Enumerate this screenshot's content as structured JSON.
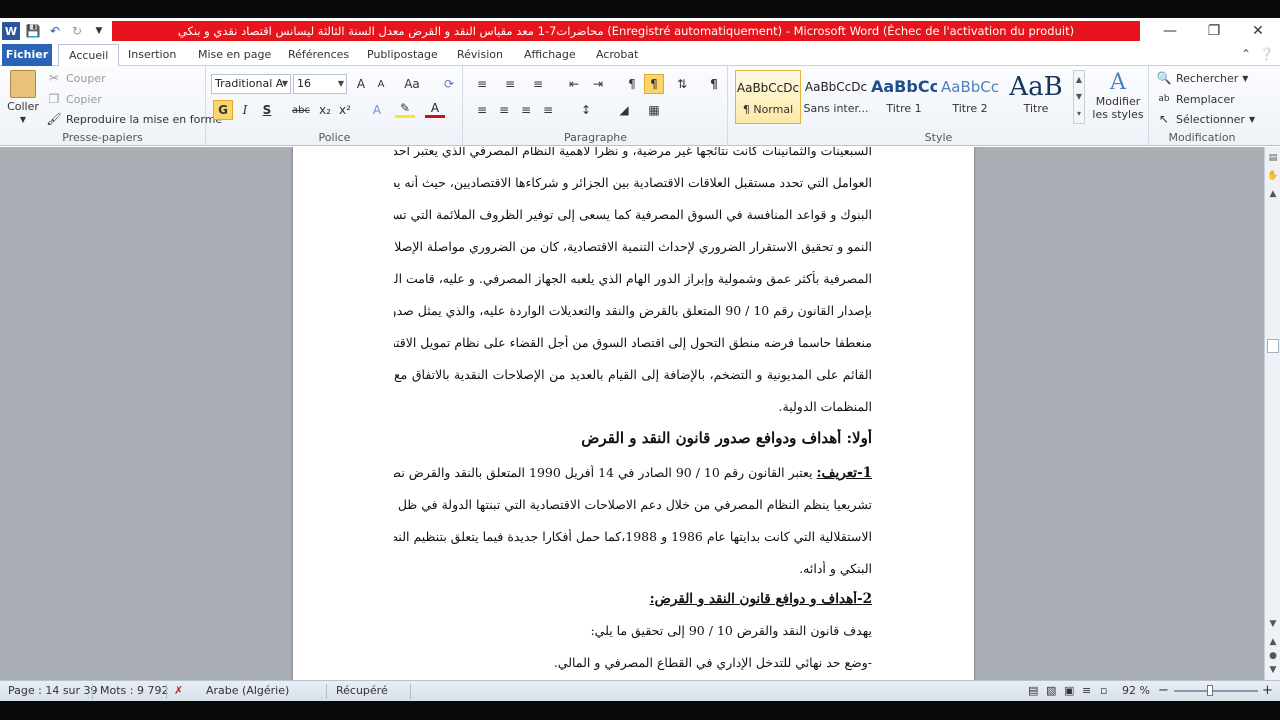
{
  "window": {
    "title": "محاضرات7-1  معد مقياس النقد و القرض معدل السنة الثالثة ليسانس اقتصاد نقدي و بنكي (Enregistré automatiquement)  -  Microsoft Word (Échec de l'activation du produit)",
    "app_icon": "W"
  },
  "tabs": [
    "Fichier",
    "Accueil",
    "Insertion",
    "Mise en page",
    "Références",
    "Publipostage",
    "Révision",
    "Affichage",
    "Acrobat"
  ],
  "ribbon": {
    "clipboard": {
      "paste_label": "Coller",
      "cut_label": "Couper",
      "copy_label": "Copier",
      "format_painter_label": "Reproduire la mise en forme",
      "group_label": "Presse-papiers"
    },
    "font": {
      "font_name": "Traditional A",
      "font_size": "16",
      "bold_glyph": "G",
      "italic_glyph": "I",
      "underline_glyph": "S",
      "strike_glyph": "abc",
      "sub_glyph": "x₂",
      "sup_glyph": "x²",
      "grow_glyph": "A",
      "shrink_glyph": "A",
      "case_glyph": "Aa",
      "color_glyph": "A",
      "group_label": "Police"
    },
    "paragraph": {
      "group_label": "Paragraphe"
    },
    "styles": {
      "items": [
        {
          "sample": "AaBbCcDc",
          "name": "¶ Normal"
        },
        {
          "sample": "AaBbCcDc",
          "name": "Sans inter..."
        },
        {
          "sample": "AaBbCc",
          "name": "Titre 1"
        },
        {
          "sample": "AaBbCc",
          "name": "Titre 2"
        },
        {
          "sample": "AaB",
          "name": "Titre"
        }
      ],
      "modify_label_1": "Modifier",
      "modify_label_2": "les styles",
      "group_label": "Style"
    },
    "editing": {
      "find_label": "Rechercher",
      "replace_label": "Remplacer",
      "select_label": "Sélectionner",
      "group_label": "Modification"
    }
  },
  "document": {
    "lines": [
      "السبعينات والثمانينات كانت نتائجها غير مرضية، و نظرا لأهمية النظام المصرفي الذي يعتبر أحد أهم",
      "العوامل التي تحدد مستقبل العلاقات الاقتصادية بين الجزائر و شركاءها الاقتصاديين، حيث أنه يضبط",
      "البنوك و قواعد المنافسة في السوق المصرفية كما يسعى إلى توفير الظروف الملائمة التي تسمح بالتطور و",
      "النمو و تحقيق الاستقرار الضروري لإحداث التنمية الاقتصادية، كان من الضروري مواصلة الإصلاحات",
      "المصرفية بأكثر عمق وشمولية وإبراز الدور الهام الذي يلعبه الجهاز المصرفي. و عليه، قامت السلطات",
      "بإصدار القانون رقم 10 / 90 المتعلق بالقرض والنقد والتعديلات الواردة عليه، والذي يمثل صدوره",
      "منعطفا حاسما فرضه منطق التحول إلى اقتصاد السوق من أجل القضاء على نظام تمويل الاقتصاد الوطني",
      "القائم على المديونية و التضخم، بالإضافة إلى القيام بالعديد من الإصلاحات النقدية بالاتفاق مع",
      "المنظمات الدولية."
    ],
    "heading": "أولا: أهداف ودوافع صدور قانون النقد و القرض",
    "def_label": "1-تعريف:",
    "def_lines": [
      "يعتبر القانون رقم 10 / 90 الصادر في 14 أفريل 1990 المتعلق بالنقد والقرض نصا",
      "تشريعيا ينظم النظام المصرفي من خلال دعم الاصلاحات الاقتصادية التي تبنتها الدولة في ظل سياسة",
      "الاستقلالية التي كانت بدايتها عام 1986 و 1988،كما حمل أفكارا جديدة فيما يتعلق بتنظيم النظام",
      "البنكي و أدائه."
    ],
    "sub_heading": "2-أهداف و دوافع قانون النقد و القرض:",
    "aim_lines": [
      "يهدف قانون النقد والقرض 10 / 90 إلى تحقيق ما يلي:",
      "-وضع حد نهائي للتدخل الإداري في القطاع المصرفي و المالي."
    ]
  },
  "status": {
    "page": "Page : 14 sur 39",
    "words": "Mots : 9 792",
    "language": "Arabe (Algérie)",
    "state": "Récupéré",
    "zoom": "92 %",
    "zoom_minus": "−",
    "zoom_plus": "+"
  },
  "colors": {
    "title_strip": "#e8141c",
    "file_tab": "#2b63b8",
    "page_bg": "#a9aeb5"
  }
}
